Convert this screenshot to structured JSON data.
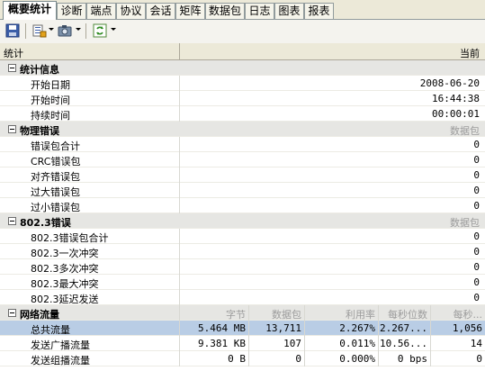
{
  "tabs": [
    {
      "label": "概要统计",
      "active": true
    },
    {
      "label": "诊断"
    },
    {
      "label": "端点"
    },
    {
      "label": "协议"
    },
    {
      "label": "会话"
    },
    {
      "label": "矩阵"
    },
    {
      "label": "数据包"
    },
    {
      "label": "日志"
    },
    {
      "label": "图表"
    },
    {
      "label": "报表"
    }
  ],
  "toolbar": {
    "icons": [
      "save-icon",
      "view-options-icon",
      "capture-icon",
      "refresh-icon"
    ]
  },
  "grid": {
    "col_stat": "统计",
    "col_current": "当前"
  },
  "sections": {
    "stats": {
      "title": "统计信息",
      "rows": [
        {
          "label": "开始日期",
          "value": "2008-06-20"
        },
        {
          "label": "开始时间",
          "value": "16:44:38"
        },
        {
          "label": "持续时间",
          "value": "00:00:01"
        }
      ]
    },
    "phys": {
      "title": "物理错误",
      "right": "数据包",
      "rows": [
        {
          "label": "错误包合计",
          "value": "0"
        },
        {
          "label": "CRC错误包",
          "value": "0"
        },
        {
          "label": "对齐错误包",
          "value": "0"
        },
        {
          "label": "过大错误包",
          "value": "0"
        },
        {
          "label": "过小错误包",
          "value": "0"
        }
      ]
    },
    "eth": {
      "title": "802.3错误",
      "right": "数据包",
      "rows": [
        {
          "label": "802.3错误包合计",
          "value": "0"
        },
        {
          "label": "802.3一次冲突",
          "value": "0"
        },
        {
          "label": "802.3多次冲突",
          "value": "0"
        },
        {
          "label": "802.3最大冲突",
          "value": "0"
        },
        {
          "label": "802.3延迟发送",
          "value": "0"
        }
      ]
    },
    "traffic": {
      "title": "网络流量",
      "headers": [
        "字节",
        "数据包",
        "利用率",
        "每秒位数",
        "每秒..."
      ],
      "rows": [
        {
          "label": "总共流量",
          "bytes": "5.464 MB",
          "packets": "13,711",
          "util": "2.267%",
          "bps": "2.267...",
          "pps": "1,056",
          "selected": true
        },
        {
          "label": "发送广播流量",
          "bytes": "9.381 KB",
          "packets": "107",
          "util": "0.011%",
          "bps": "10.56...",
          "pps": "14"
        },
        {
          "label": "发送组播流量",
          "bytes": "0   B",
          "packets": "0",
          "util": "0.000%",
          "bps": "0 bps",
          "pps": "0"
        }
      ]
    }
  }
}
